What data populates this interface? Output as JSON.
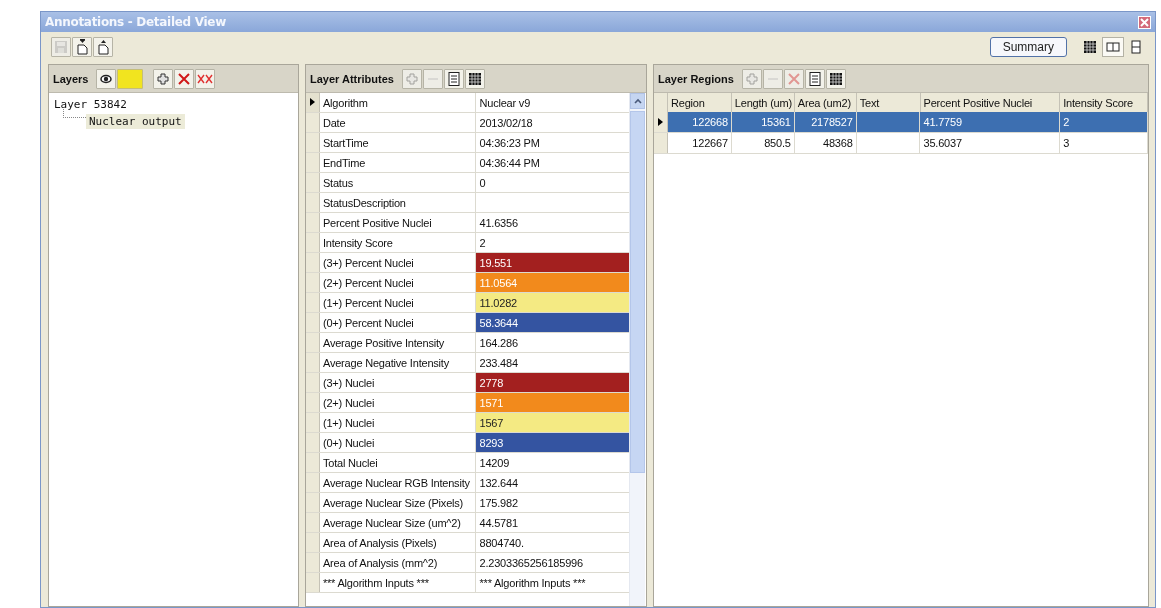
{
  "window": {
    "title": "Annotations - Detailed View"
  },
  "toolbar": {
    "buttons": [
      {
        "kind": "save",
        "disabled": true
      },
      {
        "kind": "export",
        "disabled": false
      },
      {
        "kind": "import",
        "disabled": false
      }
    ],
    "summary_button": "Summary",
    "view_buttons": [
      {
        "kind": "grid",
        "selected": false
      },
      {
        "kind": "columns",
        "selected": true
      },
      {
        "kind": "rows",
        "selected": false
      }
    ]
  },
  "layers": {
    "title": "Layers",
    "tools": [
      {
        "kind": "eye",
        "disabled": false
      },
      {
        "kind": "swatch",
        "disabled": false
      },
      {
        "kind": "add",
        "disabled": false
      },
      {
        "kind": "delete",
        "disabled": false
      },
      {
        "kind": "delete-all",
        "disabled": false
      }
    ],
    "tree": [
      {
        "label": "Layer 53842",
        "selected": false,
        "children": [
          {
            "label": "Nuclear output",
            "selected": true
          }
        ]
      }
    ]
  },
  "attributes": {
    "title": "Layer Attributes",
    "tools": [
      {
        "kind": "add",
        "disabled": true
      },
      {
        "kind": "remove",
        "disabled": true
      },
      {
        "kind": "list",
        "disabled": false
      },
      {
        "kind": "grid",
        "disabled": false
      }
    ],
    "rows": [
      {
        "name": "Algorithm",
        "value": "Nuclear v9",
        "current": true
      },
      {
        "name": "Date",
        "value": "2013/02/18",
        "current": false
      },
      {
        "name": "StartTime",
        "value": "04:36:23 PM",
        "current": false
      },
      {
        "name": "EndTime",
        "value": "04:36:44 PM",
        "current": false
      },
      {
        "name": "Status",
        "value": "0",
        "current": false
      },
      {
        "name": "StatusDescription",
        "current": false
      },
      {
        "name": "Percent Positive Nuclei",
        "value": "41.6356",
        "current": false
      },
      {
        "name": "Intensity Score",
        "value": "2",
        "current": false
      },
      {
        "name": "(3+) Percent Nuclei",
        "value": "19.551",
        "color": "#a3201f",
        "current": false
      },
      {
        "name": "(2+) Percent Nuclei",
        "value": "11.0564",
        "color": "#f28a1c",
        "current": false
      },
      {
        "name": "(1+) Percent Nuclei",
        "value": "11.0282",
        "color": "#f4ea83",
        "current": false
      },
      {
        "name": "(0+) Percent Nuclei",
        "value": "58.3644",
        "color": "#3454a1",
        "current": false
      },
      {
        "name": "Average Positive Intensity",
        "value": "164.286",
        "current": false
      },
      {
        "name": "Average Negative Intensity",
        "value": "233.484",
        "current": false
      },
      {
        "name": "(3+) Nuclei",
        "value": "2778",
        "color": "#a3201f",
        "current": false
      },
      {
        "name": "(2+) Nuclei",
        "value": "1571",
        "color": "#f28a1c",
        "current": false
      },
      {
        "name": "(1+) Nuclei",
        "value": "1567",
        "color": "#f4ea83",
        "current": false
      },
      {
        "name": "(0+) Nuclei",
        "value": "8293",
        "color": "#3454a1",
        "current": false
      },
      {
        "name": "Total Nuclei",
        "value": "14209",
        "current": false
      },
      {
        "name": "Average Nuclear RGB Intensity",
        "value": "132.644",
        "current": false
      },
      {
        "name": "Average Nuclear Size (Pixels)",
        "value": "175.982",
        "current": false
      },
      {
        "name": "Average Nuclear Size (um^2)",
        "value": "44.5781",
        "current": false
      },
      {
        "name": "Area of Analysis (Pixels)",
        "value": "8804740.",
        "current": false
      },
      {
        "name": "Area of Analysis (mm^2)",
        "value": "2.2303365256185996",
        "current": false
      },
      {
        "name": "*** Algorithm Inputs ***",
        "value": "*** Algorithm Inputs ***",
        "current": false
      }
    ]
  },
  "regions": {
    "title": "Layer Regions",
    "tools": [
      {
        "kind": "add",
        "disabled": true
      },
      {
        "kind": "remove",
        "disabled": true
      },
      {
        "kind": "delete",
        "disabled": true
      },
      {
        "kind": "list",
        "disabled": false
      },
      {
        "kind": "grid",
        "disabled": false
      }
    ],
    "columns": [
      "Region",
      "Length (um)",
      "Area (um2)",
      "Text",
      "Percent Positive Nuclei",
      "Intensity Score"
    ],
    "rows": [
      {
        "cells": [
          "122668",
          "15361",
          "2178527",
          "",
          "41.7759",
          "2"
        ],
        "selected": true
      },
      {
        "cells": [
          "122667",
          "850.5",
          "48368",
          "",
          "35.6037",
          "3"
        ],
        "selected": false
      }
    ]
  }
}
